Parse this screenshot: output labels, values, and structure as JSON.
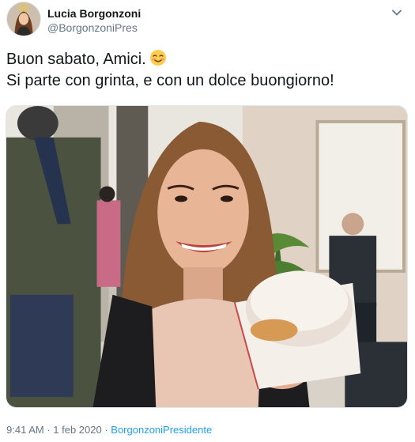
{
  "author": {
    "name": "Lucia Borgonzoni",
    "handle": "@BorgonzoniPres"
  },
  "tweet": {
    "line1": "Buon sabato, Amici.",
    "line2": "Si parte con grinta, e con un dolce buongiorno!",
    "emoji": "smiling-face-with-blush"
  },
  "footer": {
    "time": "9:41 AM",
    "separator1": " · ",
    "date": "1 feb 2020",
    "separator2": " · ",
    "source": "BorgonzoniPresidente"
  },
  "colors": {
    "text": "#14171a",
    "secondary": "#657786",
    "link": "#1da1f2",
    "border": "#e1e8ed"
  }
}
